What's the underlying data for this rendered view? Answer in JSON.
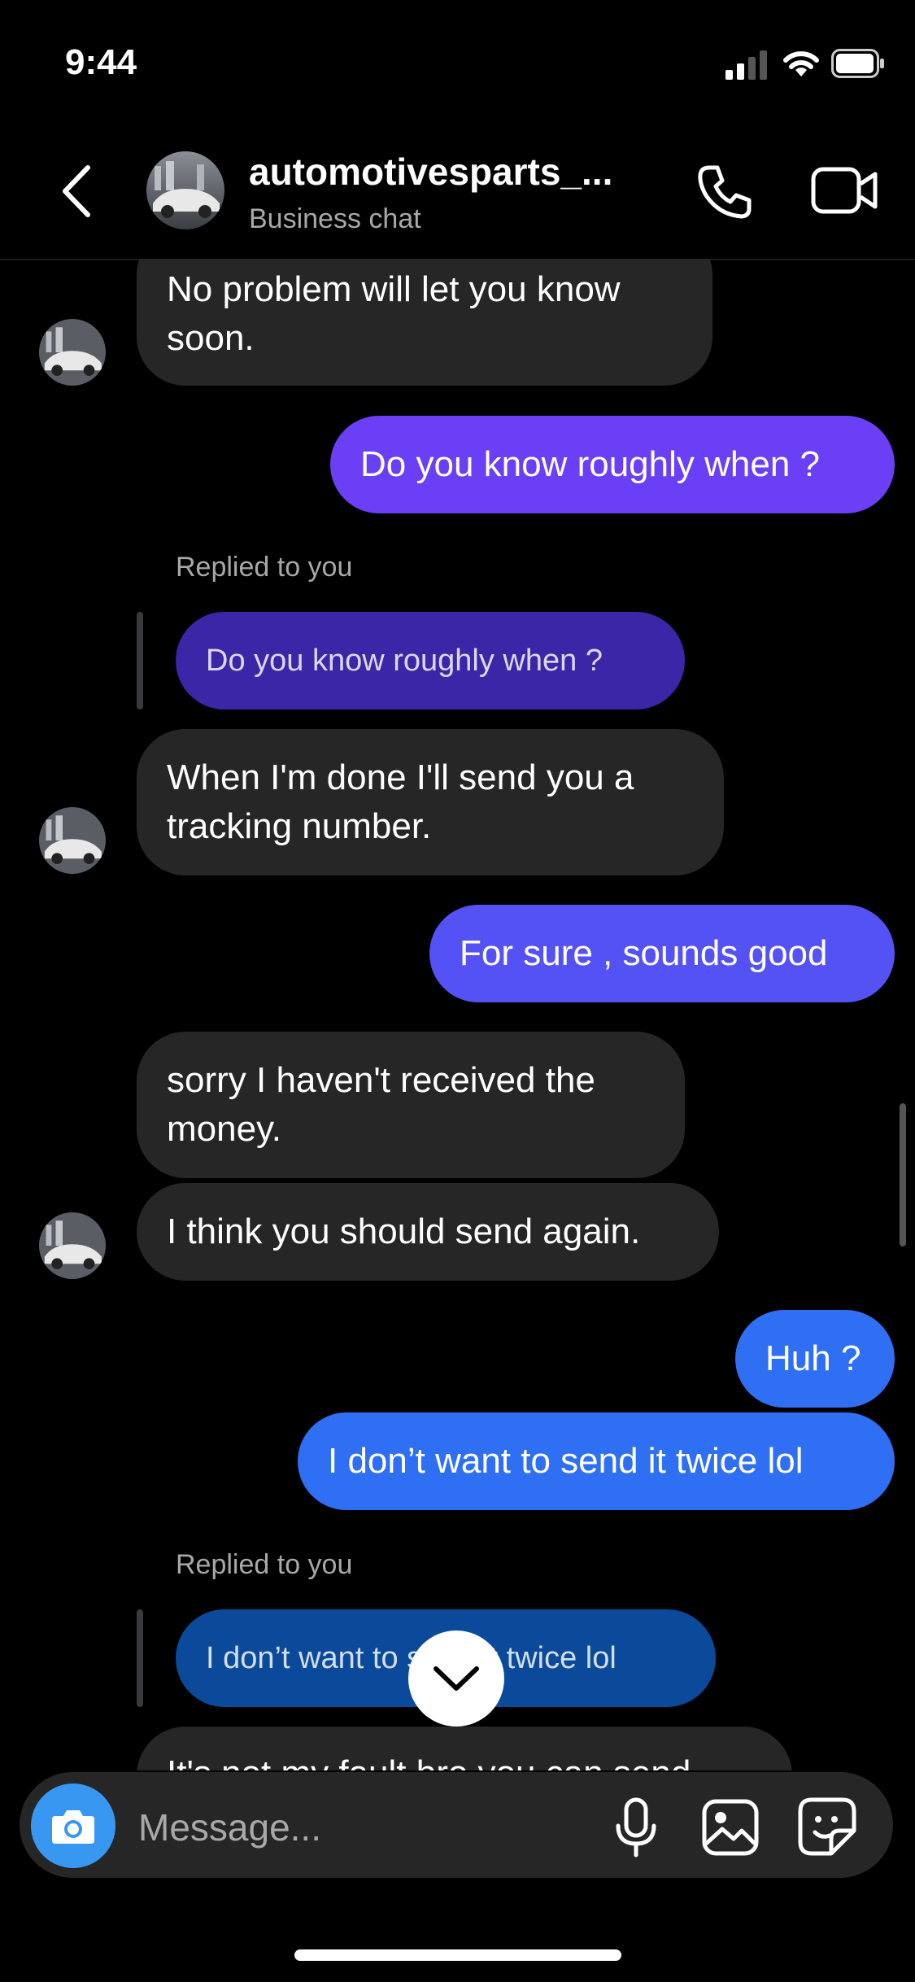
{
  "status": {
    "time": "9:44"
  },
  "header": {
    "name": "automotivesparts_...",
    "subtitle": "Business chat"
  },
  "messages": [
    {
      "from": "them",
      "text": "No problem will let you know soon."
    },
    {
      "from": "me",
      "text": "Do you know roughly when ?"
    },
    {
      "from": "them",
      "reply_label": "Replied to you",
      "quoted": "Do you know roughly when ?",
      "text": "When I'm done I'll send you a tracking number."
    },
    {
      "from": "me",
      "text": "For sure , sounds good"
    },
    {
      "from": "them",
      "text": "sorry I haven't received the money."
    },
    {
      "from": "them",
      "text": "I think you should send again."
    },
    {
      "from": "me",
      "text": "Huh ?"
    },
    {
      "from": "me",
      "text": "I don’t want to send it twice lol"
    },
    {
      "from": "them",
      "reply_label": "Replied to you",
      "quoted": "I don’t want to send it twice lol",
      "text": "It's not my fault bro you can send"
    }
  ],
  "composer": {
    "placeholder": "Message..."
  },
  "colors": {
    "accent": "#3897f0",
    "bubble_in": "#262626",
    "bubble_out_purple": "#6a3ff5",
    "bubble_out_blue": "#2f6ff4",
    "quote_purple": "#3a26a6",
    "quote_blue": "#0b4a9a"
  },
  "icons": {
    "back": "chevron-left-icon",
    "call": "phone-icon",
    "video": "video-camera-icon",
    "camera": "camera-icon",
    "mic": "microphone-icon",
    "gallery": "image-icon",
    "sticker": "sticker-icon",
    "scroll": "chevron-down-icon"
  }
}
